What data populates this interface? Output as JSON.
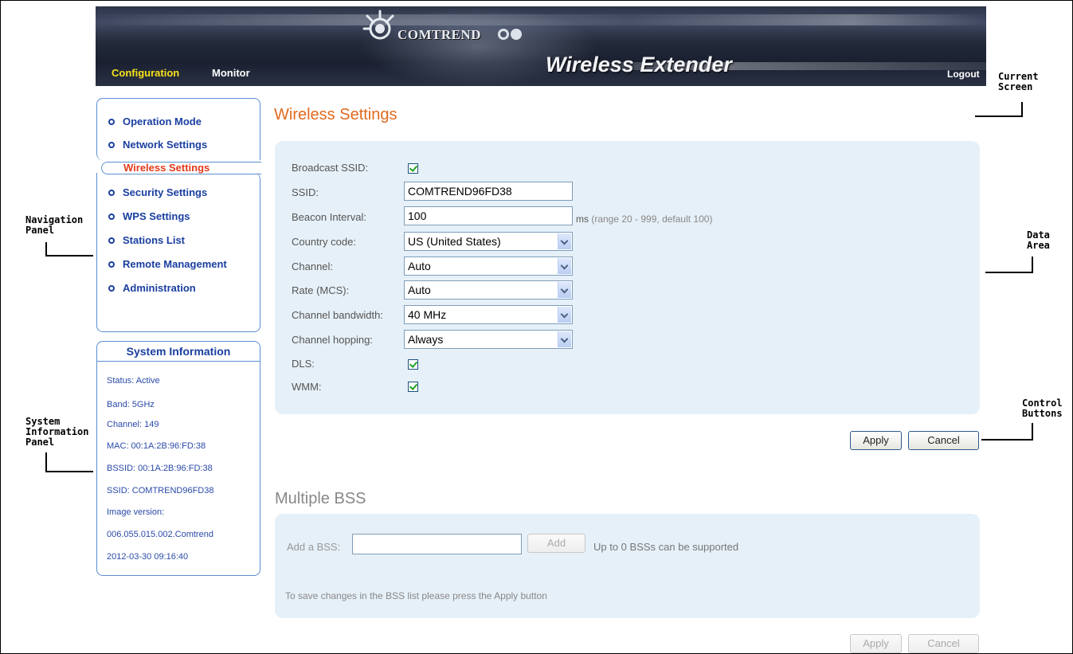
{
  "header": {
    "logo_text": "COMTREND",
    "product_title": "Wireless Extender",
    "tabs": [
      {
        "label": "Configuration",
        "active": true
      },
      {
        "label": "Monitor",
        "active": false
      }
    ],
    "logout_label": "Logout",
    "accent_color": "#f7e21a"
  },
  "callouts": {
    "current_screen": [
      "Current",
      "Screen"
    ],
    "navigation_panel": [
      "Navigation",
      "Panel"
    ],
    "data_area": [
      "Data",
      "Area"
    ],
    "system_information_panel": [
      "System",
      "Information",
      "Panel"
    ],
    "control_buttons": [
      "Control",
      "Buttons"
    ]
  },
  "sidebar": {
    "items": [
      {
        "label": "Operation Mode",
        "selected": false,
        "icon": "bullet-circle-icon"
      },
      {
        "label": "Network Settings",
        "selected": false,
        "icon": "bullet-circle-icon"
      },
      {
        "label": "Wireless Settings",
        "selected": true,
        "icon": ""
      },
      {
        "label": "Security Settings",
        "selected": false,
        "icon": "bullet-circle-icon"
      },
      {
        "label": "WPS Settings",
        "selected": false,
        "icon": "bullet-circle-icon"
      },
      {
        "label": "Stations List",
        "selected": false,
        "icon": "bullet-circle-icon"
      },
      {
        "label": "Remote Management",
        "selected": false,
        "icon": "bullet-circle-icon"
      },
      {
        "label": "Administration",
        "selected": false,
        "icon": "bullet-circle-icon"
      }
    ],
    "selected_color": "#e23a1a",
    "link_color": "#1a3fa0"
  },
  "system_info": {
    "title": "System Information",
    "lines": [
      "Status: Active",
      "Band: 5GHz",
      "Channel: 149",
      "MAC: 00:1A:2B:96:FD:38",
      "BSSID: 00:1A:2B:96:FD:38",
      "SSID: COMTREND96FD38",
      "Image version:",
      "006.055.015.002.Comtrend",
      "2012-03-30 09:16:40"
    ]
  },
  "main": {
    "title": "Wireless Settings",
    "title_color": "#e06a1e",
    "fields": {
      "broadcast_ssid": {
        "label": "Broadcast SSID:",
        "checked": true
      },
      "ssid": {
        "label": "SSID:",
        "value": "COMTREND96FD38"
      },
      "beacon_interval": {
        "label": "Beacon Interval:",
        "value": "100",
        "unit": "ms",
        "note": "(range 20 - 999, default 100)"
      },
      "country_code": {
        "label": "Country code:",
        "value": "US (United States)"
      },
      "channel": {
        "label": "Channel:",
        "value": "Auto"
      },
      "rate": {
        "label": "Rate (MCS):",
        "value": "Auto"
      },
      "channel_bandwidth": {
        "label": "Channel bandwidth:",
        "value": "40 MHz"
      },
      "channel_hopping": {
        "label": "Channel hopping:",
        "value": "Always"
      },
      "dls": {
        "label": "DLS:",
        "checked": true
      },
      "wmm": {
        "label": "WMM:",
        "checked": true
      }
    },
    "apply_label": "Apply",
    "cancel_label": "Cancel"
  },
  "bss": {
    "title": "Multiple BSS",
    "add_label": "Add a BSS:",
    "add_input_value": "",
    "add_button_label": "Add",
    "limit_text": "Up to 0 BSSs can be supported",
    "note": "To save changes in the BSS list please press the Apply button",
    "apply_label": "Apply",
    "cancel_label": "Cancel"
  }
}
